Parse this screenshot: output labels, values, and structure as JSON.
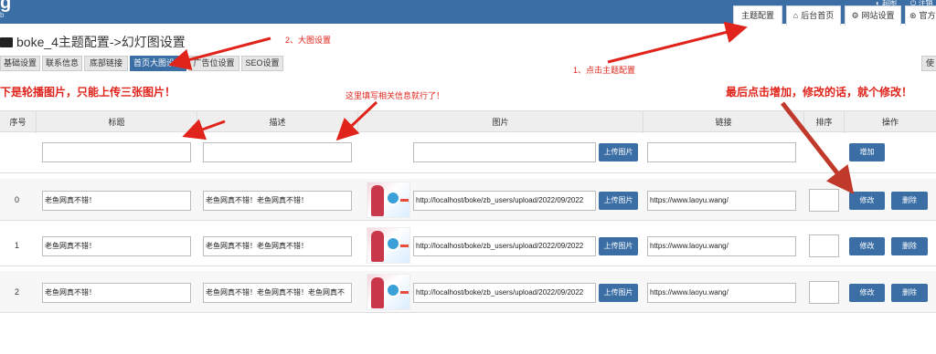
{
  "header": {
    "logo": "g",
    "logo_sub": "b",
    "toplinks": [
      "超图",
      "注销"
    ],
    "tabs": [
      {
        "icon": "",
        "label": "主题配置"
      },
      {
        "icon": "home-icon",
        "label": "后台首页"
      },
      {
        "icon": "gear-icon",
        "label": "网站设置"
      },
      {
        "icon": "user-icon",
        "label": "官方"
      }
    ]
  },
  "page": {
    "title": "boke_4主题配置->幻灯图设置"
  },
  "subtabs": [
    {
      "label": "基础设置"
    },
    {
      "label": "联系信息"
    },
    {
      "label": "底部链接"
    },
    {
      "label": "首页大图设置"
    },
    {
      "label": "广告位设置"
    },
    {
      "label": "SEO设置"
    }
  ],
  "right_cut_label": "使",
  "annotations": {
    "big_image": "2、大图设置",
    "click_theme": "1、点击主题配置",
    "fill_info": "这里填写相关信息就行了！",
    "carousel_note": "下是轮播图片，只能上传三张图片！",
    "final_note": "最后点击增加，修改的话，就个修改！"
  },
  "table": {
    "headers": [
      "序号",
      "标题",
      "描述",
      "图片",
      "链接",
      "排序",
      "操作"
    ],
    "new_row": {
      "upload_label": "上传图片",
      "add_label": "增加"
    },
    "rows": [
      {
        "index": "0",
        "title": "老鱼网真不错！",
        "desc": "老鱼网真不错！老鱼网真不错！",
        "image": "http://localhost/boke/zb_users/upload/2022/09/2022",
        "link": "https://www.laoyu.wang/",
        "order": ""
      },
      {
        "index": "1",
        "title": "老鱼网真不错！",
        "desc": "老鱼网真不错！老鱼网真不错！",
        "image": "http://localhost/boke/zb_users/upload/2022/09/2022",
        "link": "https://www.laoyu.wang/",
        "order": ""
      },
      {
        "index": "2",
        "title": "老鱼网真不错！",
        "desc": "老鱼网真不错！老鱼网真不错！老鱼网真不",
        "image": "http://localhost/boke/zb_users/upload/2022/09/2022",
        "link": "https://www.laoyu.wang/",
        "order": ""
      }
    ],
    "upload_label": "上传图片",
    "edit_label": "修改",
    "delete_label": "删除"
  },
  "colors": {
    "topbar": "#3a6ea5",
    "button": "#3a6ea5",
    "annotation": "#e0231b"
  }
}
